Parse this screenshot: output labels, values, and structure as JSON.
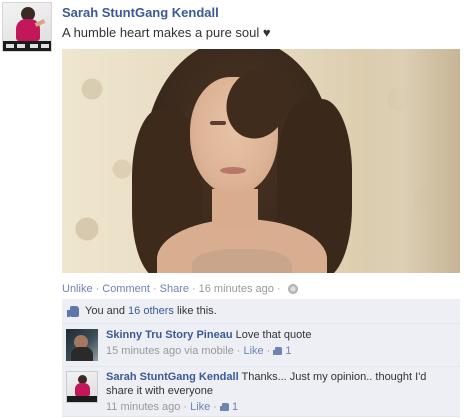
{
  "post": {
    "author_name": "Sarah StuntGang Kendall",
    "status_text": "A humble heart makes a pure soul ♥",
    "actions": {
      "unlike": "Unlike",
      "comment": "Comment",
      "share": "Share",
      "timestamp": "16 minutes ago",
      "separator": "·"
    },
    "likes": {
      "you_and": "You and ",
      "others_link": "16 others",
      "suffix": " like this."
    }
  },
  "comments": [
    {
      "author": "Skinny Tru Story Pineau",
      "text": " Love that quote",
      "time": "15 minutes ago via mobile",
      "like_label": "Like",
      "like_count": "1"
    },
    {
      "author": "Sarah StuntGang Kendall",
      "text": " Thanks... Just my opinion.. thought I'd share it with everyone",
      "time": "11 minutes ago",
      "like_label": "Like",
      "like_count": "1"
    }
  ],
  "colors": {
    "link_blue": "#3b5998",
    "meta_link": "#6d84b4",
    "ufi_background": "#edeff4"
  },
  "icons": [
    "globe-icon",
    "like-thumb-icon"
  ]
}
